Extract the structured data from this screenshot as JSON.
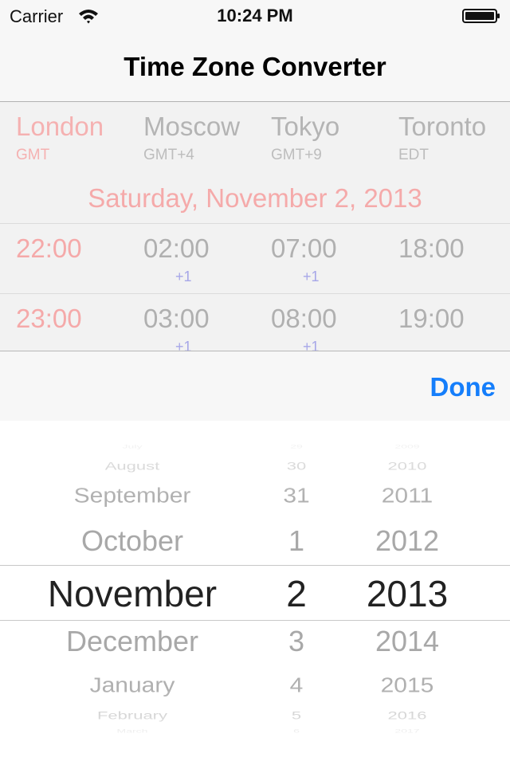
{
  "status_bar": {
    "carrier": "Carrier",
    "time": "10:24 PM"
  },
  "nav": {
    "title": "Time Zone Converter"
  },
  "zones": [
    {
      "name": "London",
      "abbr": "GMT"
    },
    {
      "name": "Moscow",
      "abbr": "GMT+4"
    },
    {
      "name": "Tokyo",
      "abbr": "GMT+9"
    },
    {
      "name": "Toronto",
      "abbr": "EDT"
    }
  ],
  "date_line": "Saturday, November 2, 2013",
  "time_rows": [
    {
      "times": [
        "22:00",
        "02:00",
        "07:00",
        "18:00"
      ],
      "offsets": [
        "",
        "+1",
        "+1",
        ""
      ]
    },
    {
      "times": [
        "23:00",
        "03:00",
        "08:00",
        "19:00"
      ],
      "offsets": [
        "",
        "+1",
        "+1",
        ""
      ]
    }
  ],
  "toolbar": {
    "done_label": "Done"
  },
  "picker": {
    "months": [
      "July",
      "August",
      "September",
      "October",
      "November",
      "December",
      "January",
      "February",
      "March"
    ],
    "days": [
      "29",
      "30",
      "31",
      "1",
      "2",
      "3",
      "4",
      "5",
      "6"
    ],
    "years": [
      "2009",
      "2010",
      "2011",
      "2012",
      "2013",
      "2014",
      "2015",
      "2016",
      "2017"
    ],
    "selected": {
      "month": "November",
      "day": "2",
      "year": "2013"
    }
  },
  "colors": {
    "accent": "#157efb",
    "active_zone": "#f5b1b1",
    "inactive_text": "#b0b0b0",
    "offset_text": "#a7a7e8"
  }
}
